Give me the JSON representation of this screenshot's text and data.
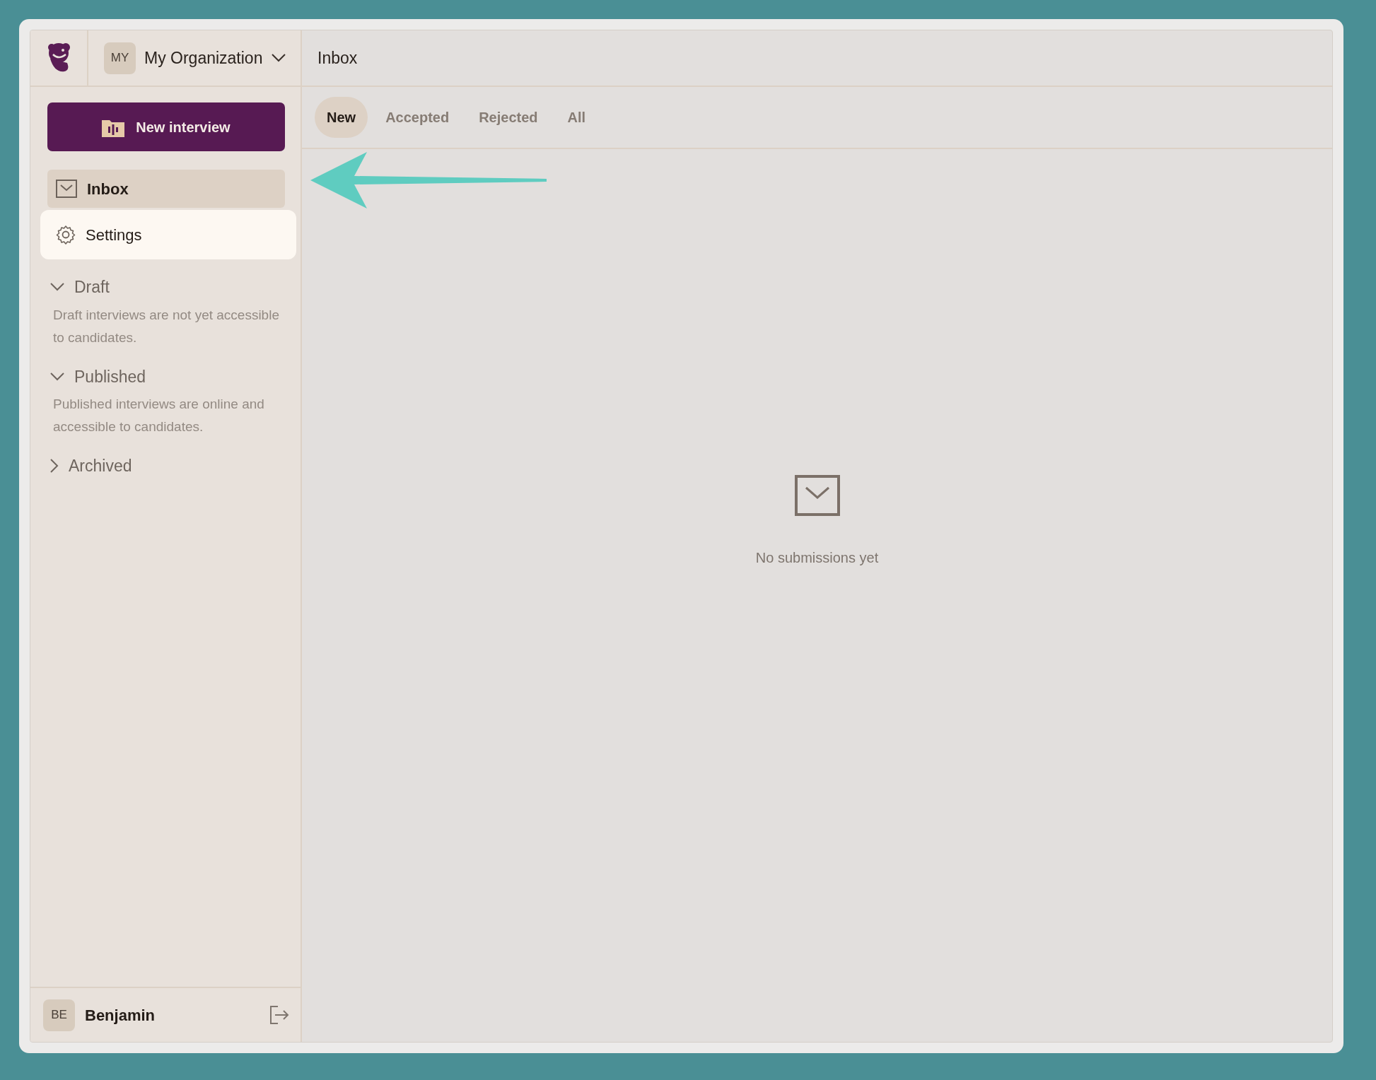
{
  "organization": {
    "initials": "MY",
    "name": "My Organization"
  },
  "header": {
    "title": "Inbox"
  },
  "new_button": {
    "label": "New interview"
  },
  "nav": [
    {
      "kind": "inbox",
      "label": "Inbox",
      "selected": true,
      "highlighted": false
    },
    {
      "kind": "settings",
      "label": "Settings",
      "selected": false,
      "highlighted": true
    }
  ],
  "sections": [
    {
      "title": "Draft",
      "expanded": true,
      "description": "Draft interviews are not yet accessible to candidates."
    },
    {
      "title": "Published",
      "expanded": true,
      "description": "Published interviews are online and accessible to candidates."
    },
    {
      "title": "Archived",
      "expanded": false
    }
  ],
  "tabs": [
    {
      "label": "New",
      "selected": true
    },
    {
      "label": "Accepted",
      "selected": false
    },
    {
      "label": "Rejected",
      "selected": false
    },
    {
      "label": "All",
      "selected": false
    }
  ],
  "empty_state": {
    "message": "No submissions yet"
  },
  "user": {
    "initials": "BE",
    "name": "Benjamin"
  }
}
